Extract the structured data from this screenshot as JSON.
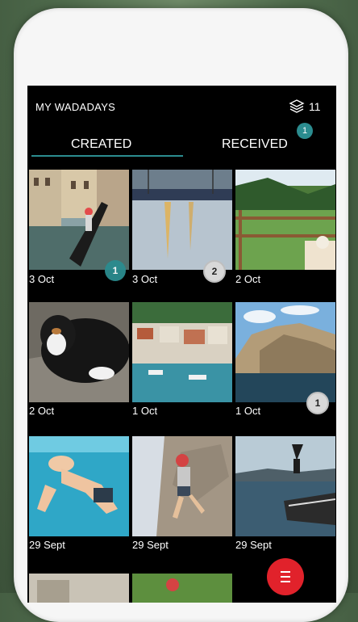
{
  "header": {
    "title": "MY WADADAYS",
    "stack_icon": "stack-icon",
    "stack_count": "11"
  },
  "tabs": [
    {
      "label": "CREATED",
      "active": true
    },
    {
      "label": "RECEIVED",
      "badge": "1"
    }
  ],
  "tiles": [
    {
      "date": "3 Oct",
      "badge": "1",
      "badge_style": "teal"
    },
    {
      "date": "3 Oct",
      "badge": "2",
      "badge_style": "grey"
    },
    {
      "date": "2 Oct"
    },
    {
      "date": "2 Oct"
    },
    {
      "date": "1 Oct"
    },
    {
      "date": "1 Oct",
      "badge": "1",
      "badge_style": "grey"
    },
    {
      "date": "29 Sept"
    },
    {
      "date": "29 Sept"
    },
    {
      "date": "29 Sept"
    }
  ],
  "fab": {
    "icon": "menu-icon"
  },
  "colors": {
    "accent": "#2b8c8f",
    "fab": "#e1222b"
  }
}
